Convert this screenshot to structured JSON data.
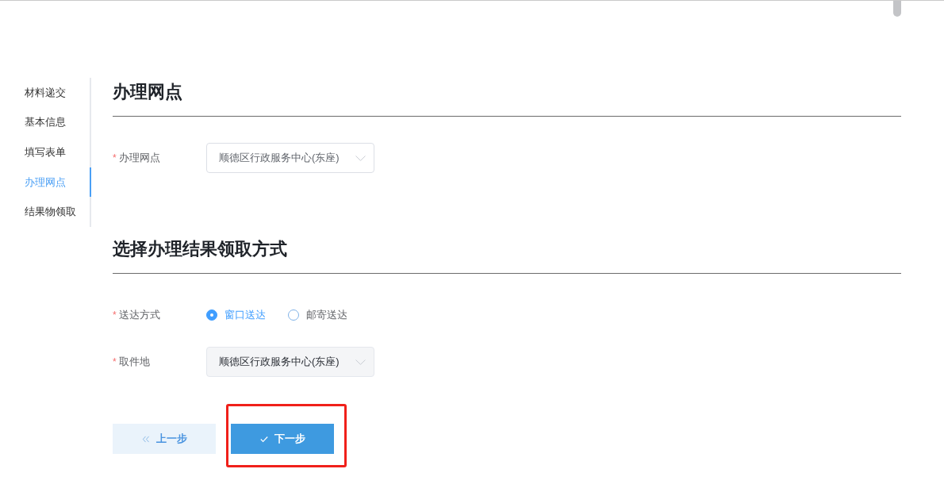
{
  "sidebar": {
    "items": [
      {
        "label": "材料递交",
        "selected": false
      },
      {
        "label": "基本信息",
        "selected": false
      },
      {
        "label": "填写表单",
        "selected": false
      },
      {
        "label": "办理网点",
        "selected": true
      },
      {
        "label": "结果物领取",
        "selected": false
      }
    ]
  },
  "sections": [
    {
      "title": "办理网点",
      "fields": [
        {
          "kind": "select",
          "required_mark": "*",
          "label": "办理网点",
          "value": "顺德区行政服务中心(东座)",
          "disabled": false
        }
      ]
    },
    {
      "title": "选择办理结果领取方式",
      "fields": [
        {
          "kind": "radio",
          "required_mark": "*",
          "label": "送达方式",
          "options": [
            {
              "label": "窗口送达",
              "selected": true
            },
            {
              "label": "邮寄送达",
              "selected": false
            }
          ]
        },
        {
          "kind": "select",
          "required_mark": "*",
          "label": "取件地",
          "value": "顺德区行政服务中心(东座)",
          "disabled": true
        }
      ]
    }
  ],
  "buttons": [
    {
      "kind": "back",
      "label": "上一步",
      "highlighted": false
    },
    {
      "kind": "next",
      "label": "下一步",
      "highlighted": true
    }
  ]
}
